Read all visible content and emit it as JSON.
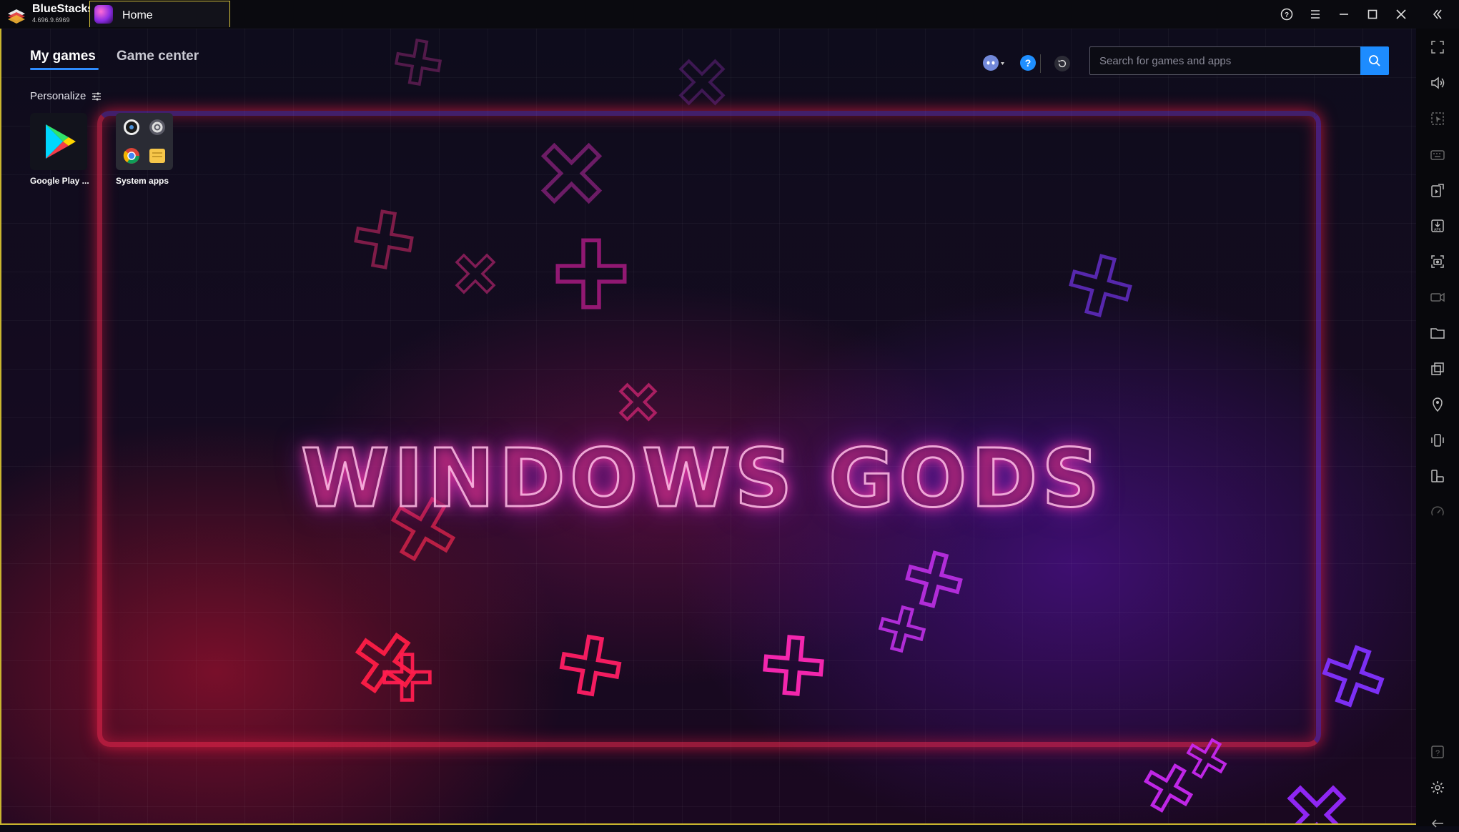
{
  "titlebar": {
    "app_name": "BlueStacks",
    "app_version": "4.696.9.6969",
    "tab_label": "Home",
    "buttons": [
      "help-icon",
      "menu-icon",
      "minimize-icon",
      "maximize-icon",
      "close-icon",
      "collapse-sidebar-icon"
    ]
  },
  "main": {
    "tabs": [
      {
        "label": "My games",
        "active": true
      },
      {
        "label": "Game center",
        "active": false
      }
    ],
    "personalize_label": "Personalize",
    "apps": [
      {
        "label": "Google Play ...",
        "icon": "google-play-icon"
      },
      {
        "label": "System apps",
        "icon": "system-apps-folder-icon"
      }
    ],
    "search": {
      "placeholder": "Search for games and apps",
      "value": ""
    },
    "wallpaper_text": "WINDOWS GODS"
  },
  "sidebar": {
    "tools": [
      "fullscreen-icon",
      "volume-icon",
      "pointer-icon",
      "keyboard-icon",
      "install-apk-icon",
      "apk-download-icon",
      "screenshot-icon",
      "record-icon",
      "folder-icon",
      "multi-instance-icon",
      "location-icon",
      "shake-icon",
      "rotate-icon",
      "eco-mode-icon",
      "help-icon",
      "settings-icon",
      "back-icon"
    ]
  },
  "colors": {
    "accent": "#1d8cff",
    "tab_border": "#d8c43a",
    "neon_red": "#ff2850",
    "neon_purple": "#8a2be2"
  }
}
